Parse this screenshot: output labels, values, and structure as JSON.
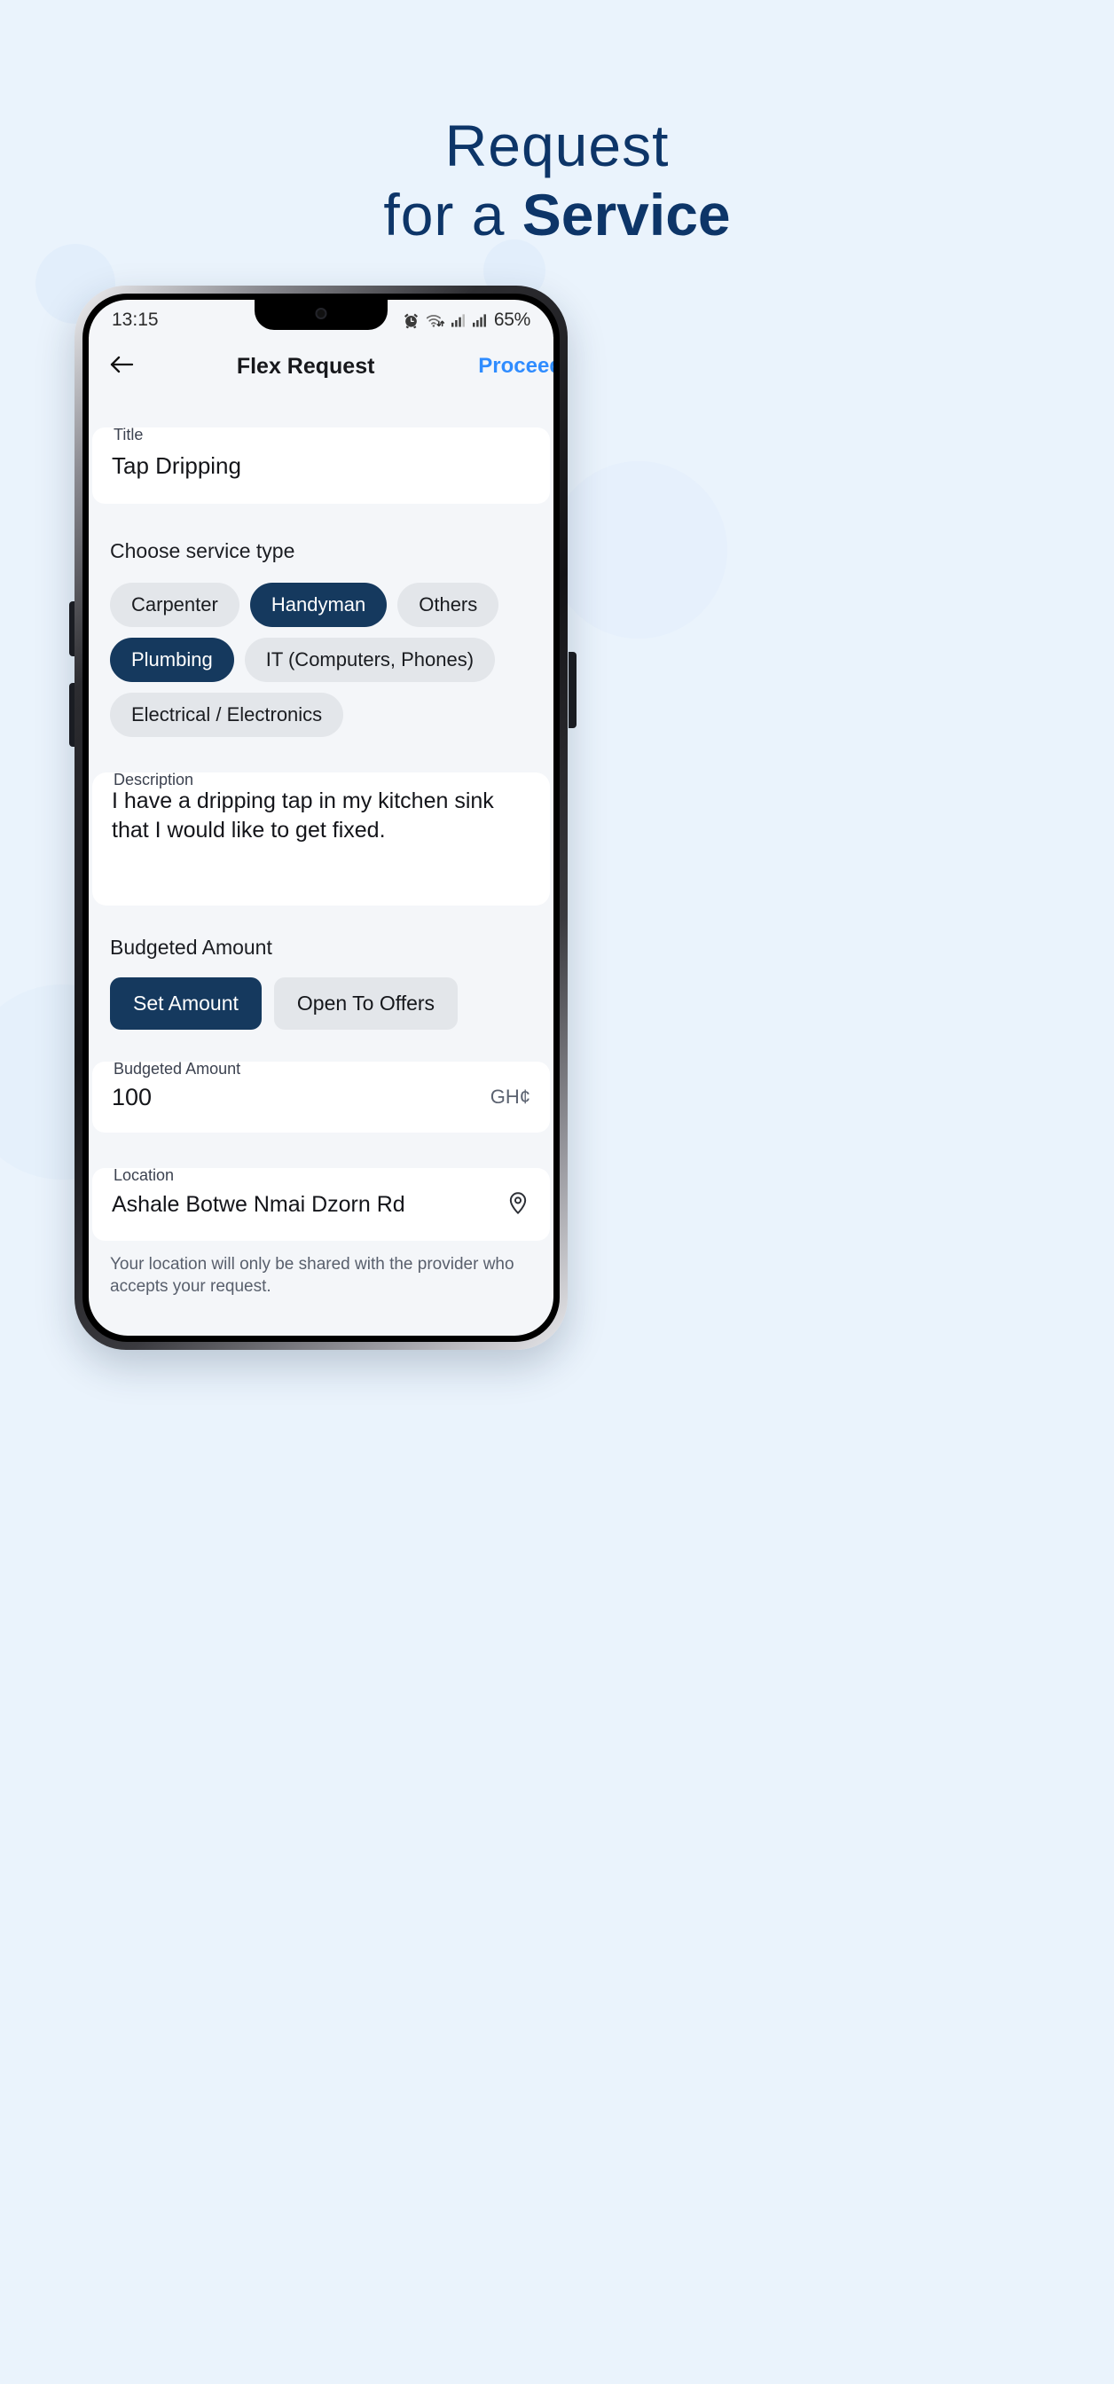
{
  "hero": {
    "line1": "Request",
    "line2_light": "for a ",
    "line2_bold": "Service"
  },
  "colors": {
    "page_bg": "#eaf3fc",
    "brand_navy": "#0d3568",
    "chip_selected": "#15395e",
    "chip_idle": "#e3e6ea",
    "proceed_blue": "#2f8cff",
    "screen_bg": "#f4f6f9"
  },
  "status_bar": {
    "time": "13:15",
    "battery": "65%",
    "icons": [
      "alarm-icon",
      "wifi-icon",
      "signal-bars-icon",
      "signal-bars-icon"
    ]
  },
  "app_bar": {
    "back_icon": "arrow-left-icon",
    "title": "Flex Request",
    "action_label": "Proceed"
  },
  "form": {
    "title_field": {
      "label": "Title",
      "value": "Tap Dripping",
      "placeholder": "Title"
    },
    "service_type": {
      "section_label": "Choose service type",
      "chips": [
        {
          "label": "Carpenter",
          "selected": false
        },
        {
          "label": "Handyman",
          "selected": true
        },
        {
          "label": "Others",
          "selected": false
        },
        {
          "label": "Plumbing",
          "selected": true
        },
        {
          "label": "IT (Computers, Phones)",
          "selected": false
        },
        {
          "label": "Electrical / Electronics",
          "selected": false
        }
      ]
    },
    "description_field": {
      "label": "Description",
      "value": "I have a dripping tap in my kitchen sink that I would like to get fixed.",
      "placeholder": "Description"
    },
    "budget": {
      "section_label": "Budgeted Amount",
      "options": [
        {
          "label": "Set Amount",
          "selected": true
        },
        {
          "label": "Open To Offers",
          "selected": false
        }
      ],
      "amount_field": {
        "label": "Budgeted Amount",
        "value": "100",
        "currency": "GH¢",
        "placeholder": "Budgeted Amount"
      }
    },
    "location_field": {
      "label": "Location",
      "value": "Ashale Botwe Nmai Dzorn Rd",
      "placeholder": "Location",
      "icon": "map-pin-icon"
    },
    "location_note": "Your location will only be shared with the provider who accepts your request."
  }
}
